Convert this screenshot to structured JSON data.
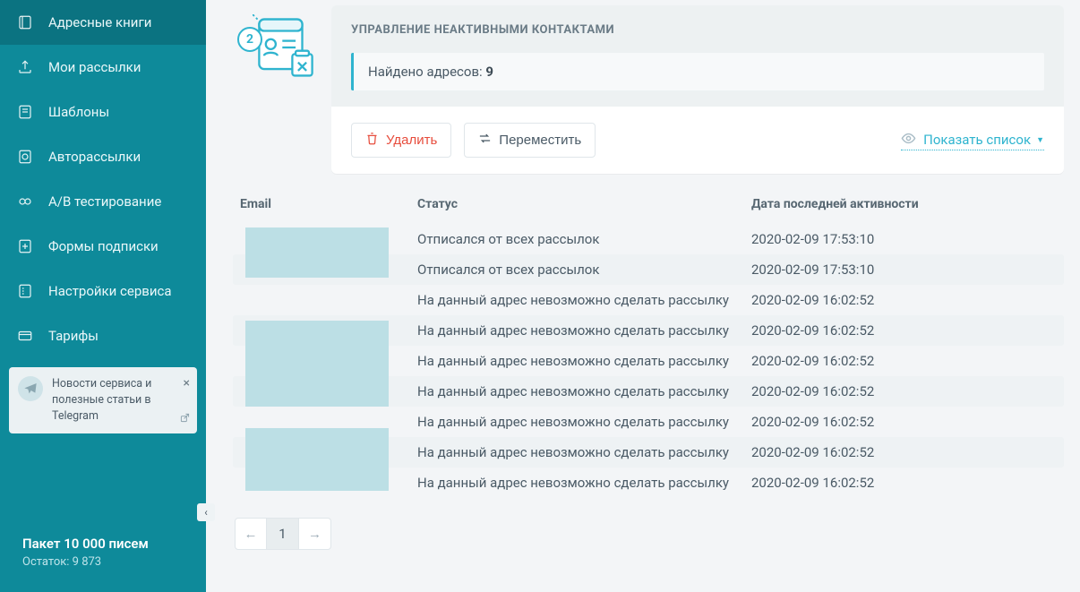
{
  "sidebar": {
    "items": [
      {
        "label": "Адресные книги",
        "icon": "book-icon",
        "active": true
      },
      {
        "label": "Мои рассылки",
        "icon": "upload-icon"
      },
      {
        "label": "Шаблоны",
        "icon": "template-icon"
      },
      {
        "label": "Авторассылки",
        "icon": "clock-icon"
      },
      {
        "label": "A/B тестирование",
        "icon": "ab-icon"
      },
      {
        "label": "Формы подписки",
        "icon": "form-icon"
      },
      {
        "label": "Настройки сервиса",
        "icon": "settings-icon"
      },
      {
        "label": "Тарифы",
        "icon": "card-icon"
      }
    ],
    "promo": "Новости сервиса и полезные статьи в Telegram",
    "plan_title": "Пакет 10 000 писем",
    "plan_balance": "Остаток: 9 873"
  },
  "step": "2",
  "panel": {
    "title": "УПРАВЛЕНИЕ НЕАКТИВНЫМИ КОНТАКТАМИ",
    "found_label": "Найдено адресов: ",
    "found_count": "9",
    "delete": "Удалить",
    "move": "Переместить",
    "show_list": "Показать список"
  },
  "table": {
    "head": {
      "email": "Email",
      "status": "Статус",
      "date": "Дата последней активности"
    },
    "rows": [
      {
        "status": "Отписался от всех рассылок",
        "date": "2020-02-09 17:53:10"
      },
      {
        "status": "Отписался от всех рассылок",
        "date": "2020-02-09 17:53:10"
      },
      {
        "status": "На данный адрес невозможно сделать рассылку",
        "date": "2020-02-09 16:02:52"
      },
      {
        "status": "На данный адрес невозможно сделать рассылку",
        "date": "2020-02-09 16:02:52"
      },
      {
        "status": "На данный адрес невозможно сделать рассылку",
        "date": "2020-02-09 16:02:52"
      },
      {
        "status": "На данный адрес невозможно сделать рассылку",
        "date": "2020-02-09 16:02:52"
      },
      {
        "status": "На данный адрес невозможно сделать рассылку",
        "date": "2020-02-09 16:02:52"
      },
      {
        "status": "На данный адрес невозможно сделать рассылку",
        "date": "2020-02-09 16:02:52"
      },
      {
        "status": "На данный адрес невозможно сделать рассылку",
        "date": "2020-02-09 16:02:52"
      }
    ]
  },
  "pager": {
    "prev": "←",
    "page": "1",
    "next": "→"
  }
}
